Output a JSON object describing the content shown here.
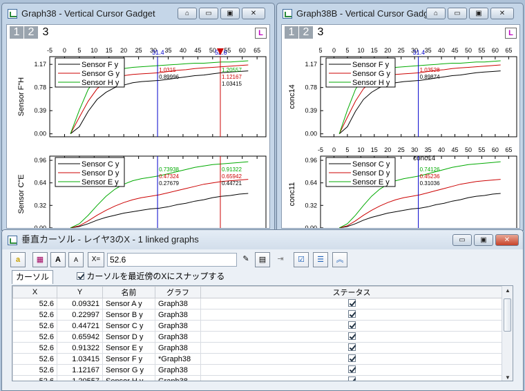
{
  "windows": {
    "left": {
      "title": "Graph38 - Vertical Cursor Gadget",
      "layer_tabs": [
        "1",
        "2",
        "3"
      ],
      "lock_label": "L"
    },
    "right": {
      "title": "Graph38B - Vertical Cursor Gadg",
      "layer_tabs": [
        "1",
        "2",
        "3"
      ],
      "lock_label": "L"
    }
  },
  "window_button_icons": [
    "home-icon",
    "minimize-icon",
    "maximize-icon",
    "close-icon"
  ],
  "chart_data": [
    {
      "type": "line",
      "window": "Graph38",
      "layer": "top",
      "xlabel": "",
      "ylabel": "Sensor F\"H",
      "xlim": [
        -5,
        68
      ],
      "ylim": [
        -0.05,
        1.3
      ],
      "xticks": [
        "-5",
        "0",
        "5",
        "10",
        "15",
        "20",
        "25",
        "30",
        "35",
        "40",
        "45",
        "50",
        "55",
        "60",
        "65"
      ],
      "yticks": [
        "0.00",
        "0.39",
        "0.78",
        "1.17"
      ],
      "legend": [
        "Sensor F y",
        "Sensor G y",
        "Sensor H y"
      ],
      "series": [
        {
          "name": "Sensor F y",
          "color": "#000000",
          "x": [
            2,
            5,
            8,
            11,
            14,
            17,
            20,
            23,
            26,
            29,
            32,
            35,
            38,
            41,
            44,
            47,
            50,
            53,
            56,
            59,
            62
          ],
          "y": [
            0.0,
            0.12,
            0.38,
            0.58,
            0.7,
            0.78,
            0.82,
            0.86,
            0.88,
            0.89,
            0.9,
            0.92,
            0.94,
            0.96,
            0.98,
            0.99,
            1.01,
            1.03,
            1.04,
            1.05,
            1.06
          ]
        },
        {
          "name": "Sensor G y",
          "color": "#cc0000",
          "x": [
            2,
            5,
            8,
            11,
            14,
            17,
            20,
            23,
            26,
            29,
            32,
            35,
            38,
            41,
            44,
            47,
            50,
            53,
            56,
            59,
            62
          ],
          "y": [
            0.0,
            0.28,
            0.55,
            0.76,
            0.88,
            0.94,
            0.98,
            1.0,
            1.01,
            1.02,
            1.03,
            1.05,
            1.07,
            1.08,
            1.1,
            1.11,
            1.12,
            1.13,
            1.14,
            1.15,
            1.16
          ]
        },
        {
          "name": "Sensor H y",
          "color": "#00aa00",
          "x": [
            2,
            5,
            8,
            11,
            14,
            17,
            20,
            23,
            26,
            29,
            32,
            35,
            38,
            41,
            44,
            47,
            50,
            53,
            56,
            59,
            62
          ],
          "y": [
            0.0,
            0.4,
            0.75,
            0.95,
            1.04,
            1.08,
            1.1,
            1.12,
            1.13,
            1.14,
            1.15,
            1.16,
            1.17,
            1.18,
            1.19,
            1.19,
            1.2,
            1.21,
            1.21,
            1.22,
            1.23
          ]
        }
      ],
      "cursors": [
        {
          "x": 31.4,
          "label": "31.4",
          "values": [
            "1.0315",
            "0.89996"
          ]
        },
        {
          "x": 52.6,
          "label": "52.6",
          "values": [
            "1.20557",
            "1.12167",
            "1.03415"
          ]
        }
      ]
    },
    {
      "type": "line",
      "window": "Graph38",
      "layer": "bottom",
      "xlabel": "",
      "ylabel": "Sensor C\"E",
      "xlim": [
        -5,
        68
      ],
      "ylim": [
        -0.06,
        1.02
      ],
      "yticks": [
        "0.00",
        "0.32",
        "0.64",
        "0.96"
      ],
      "legend": [
        "Sensor C y",
        "Sensor D y",
        "Sensor E y"
      ],
      "series": [
        {
          "name": "Sensor C y",
          "color": "#000000",
          "x": [
            2,
            5,
            8,
            11,
            14,
            17,
            20,
            23,
            26,
            29,
            32,
            35,
            38,
            41,
            44,
            47,
            50,
            53,
            56,
            59,
            62
          ],
          "y": [
            0.0,
            0.02,
            0.06,
            0.11,
            0.15,
            0.18,
            0.21,
            0.23,
            0.25,
            0.27,
            0.28,
            0.3,
            0.33,
            0.35,
            0.38,
            0.4,
            0.43,
            0.45,
            0.46,
            0.48,
            0.49
          ]
        },
        {
          "name": "Sensor D y",
          "color": "#cc0000",
          "x": [
            2,
            5,
            8,
            11,
            14,
            17,
            20,
            23,
            26,
            29,
            32,
            35,
            38,
            41,
            44,
            47,
            50,
            53,
            56,
            59,
            62
          ],
          "y": [
            0.0,
            0.03,
            0.1,
            0.18,
            0.25,
            0.31,
            0.36,
            0.4,
            0.43,
            0.45,
            0.47,
            0.5,
            0.53,
            0.56,
            0.59,
            0.62,
            0.64,
            0.66,
            0.67,
            0.68,
            0.69
          ]
        },
        {
          "name": "Sensor E y",
          "color": "#00aa00",
          "x": [
            2,
            5,
            8,
            11,
            14,
            17,
            20,
            23,
            26,
            29,
            32,
            35,
            38,
            41,
            44,
            47,
            50,
            53,
            56,
            59,
            62
          ],
          "y": [
            0.0,
            0.06,
            0.18,
            0.32,
            0.45,
            0.55,
            0.62,
            0.67,
            0.7,
            0.72,
            0.74,
            0.77,
            0.8,
            0.83,
            0.86,
            0.88,
            0.9,
            0.91,
            0.92,
            0.93,
            0.94
          ]
        }
      ],
      "cursors": [
        {
          "x": 31.4,
          "values": [
            "0.73938",
            "0.47324",
            "0.27679"
          ]
        },
        {
          "x": 52.6,
          "values": [
            "0.91322",
            "0.65942",
            "0.44721"
          ]
        }
      ]
    },
    {
      "type": "line",
      "window": "Graph38B",
      "layer": "top",
      "xlabel": "",
      "ylabel": "conc14",
      "xlim": [
        -5,
        68
      ],
      "ylim": [
        -0.05,
        1.3
      ],
      "xticks": [
        "5",
        "0",
        "5",
        "10",
        "15",
        "20",
        "25",
        "30",
        "35",
        "40",
        "45",
        "50",
        "55",
        "60",
        "65"
      ],
      "yticks": [
        "0.00",
        "0.39",
        "0.78",
        "1.17"
      ],
      "legend": [
        "Sensor F y",
        "Sensor G y",
        "Sensor H y"
      ],
      "cursors": [
        {
          "x": 31.4,
          "label": "31.4",
          "values": [
            "1.03528",
            "0.89874"
          ]
        }
      ]
    },
    {
      "type": "line",
      "window": "Graph38B",
      "layer": "bottom",
      "xlabel": "",
      "ylabel": "conc11",
      "xlim": [
        -5,
        68
      ],
      "ylim": [
        -0.06,
        1.02
      ],
      "xticks": [
        "-5",
        "0",
        "5",
        "10",
        "15",
        "20",
        "25",
        "30",
        "35",
        "40",
        "45",
        "50",
        "55",
        "60",
        "65"
      ],
      "yticks": [
        "0.00",
        "0.32",
        "0.64",
        "0.96"
      ],
      "legend": [
        "Sensor C y",
        "Sensor D y",
        "Sensor E y"
      ],
      "top_label": "conc14",
      "cursors": [
        {
          "x": 31.4,
          "values": [
            "0.74126",
            "0.45236",
            "0.31036"
          ]
        }
      ]
    }
  ],
  "dialog": {
    "title": "垂直カーソル - レイヤ3のX - 1 linked graphs",
    "x_value": "52.6",
    "tab": "カーソル",
    "snap_label": "カーソルを最近傍のXにスナップする",
    "toolbar_icons": [
      "color-icon",
      "data-icon",
      "add-text-icon",
      "remove-text-icon",
      "x-equals-button",
      "run-icon",
      "table-icon",
      "export-icon",
      "check-list-icon",
      "settings-icon",
      "collapse-icon"
    ],
    "x_equals_label": "X=",
    "columns": [
      "X",
      "Y",
      "名前",
      "グラフ",
      "ステータス"
    ],
    "rows": [
      {
        "x": "52.6",
        "y": "0.09321",
        "name": "Sensor A y",
        "graph": "Graph38"
      },
      {
        "x": "52.6",
        "y": "0.22997",
        "name": "Sensor B y",
        "graph": "Graph38"
      },
      {
        "x": "52.6",
        "y": "0.44721",
        "name": "Sensor C y",
        "graph": "Graph38"
      },
      {
        "x": "52.6",
        "y": "0.65942",
        "name": "Sensor D y",
        "graph": "Graph38"
      },
      {
        "x": "52.6",
        "y": "0.91322",
        "name": "Sensor E y",
        "graph": "Graph38"
      },
      {
        "x": "52.6",
        "y": "1.03415",
        "name": "Sensor F y",
        "graph": "*Graph38"
      },
      {
        "x": "52.6",
        "y": "1.12167",
        "name": "Sensor G y",
        "graph": "Graph38"
      },
      {
        "x": "52.6",
        "y": "1.20557",
        "name": "Sensor H y",
        "graph": "Graph38"
      }
    ]
  }
}
